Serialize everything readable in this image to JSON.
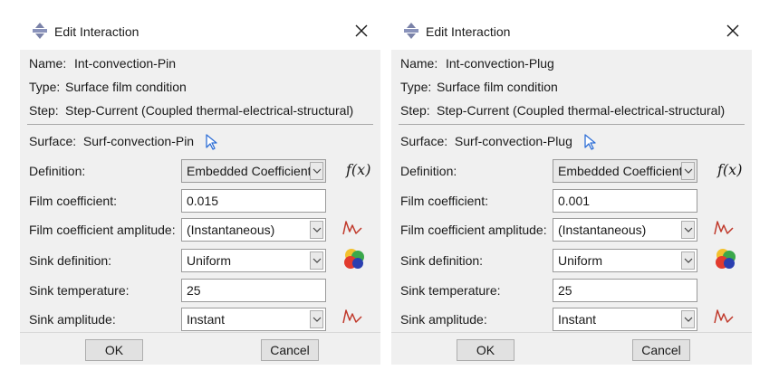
{
  "dialogs": [
    {
      "title": "Edit Interaction",
      "name_label": "Name:",
      "name_value": "Int-convection-Pin",
      "type_label": "Type:",
      "type_value": "Surface film condition",
      "step_label": "Step:",
      "step_value": "Step-Current (Coupled thermal-electrical-structural)",
      "surface_label": "Surface:",
      "surface_value": "Surf-convection-Pin",
      "definition_label": "Definition:",
      "definition_value": "Embedded Coefficient",
      "fx_label": "f(x)",
      "film_coefficient_label": "Film coefficient:",
      "film_coefficient_value": "0.015",
      "film_amplitude_label": "Film coefficient amplitude:",
      "film_amplitude_value": "(Instantaneous)",
      "sink_definition_label": "Sink definition:",
      "sink_definition_value": "Uniform",
      "sink_temperature_label": "Sink temperature:",
      "sink_temperature_value": "25",
      "sink_amplitude_label": "Sink amplitude:",
      "sink_amplitude_value": "Instant",
      "ok_label": "OK",
      "cancel_label": "Cancel"
    },
    {
      "title": "Edit Interaction",
      "name_label": "Name:",
      "name_value": "Int-convection-Plug",
      "type_label": "Type:",
      "type_value": "Surface film condition",
      "step_label": "Step:",
      "step_value": "Step-Current (Coupled thermal-electrical-structural)",
      "surface_label": "Surface:",
      "surface_value": "Surf-convection-Plug",
      "definition_label": "Definition:",
      "definition_value": "Embedded Coefficient",
      "fx_label": "f(x)",
      "film_coefficient_label": "Film coefficient:",
      "film_coefficient_value": "0.001",
      "film_amplitude_label": "Film coefficient amplitude:",
      "film_amplitude_value": "(Instantaneous)",
      "sink_definition_label": "Sink definition:",
      "sink_definition_value": "Uniform",
      "sink_temperature_label": "Sink temperature:",
      "sink_temperature_value": "25",
      "sink_amplitude_label": "Sink amplitude:",
      "sink_amplitude_value": "Instant",
      "ok_label": "OK",
      "cancel_label": "Cancel"
    }
  ],
  "icons": {
    "title": "abaqus-interaction-icon",
    "close": "close-icon",
    "select_surface": "cursor-arrow-icon",
    "function": "fx-icon",
    "amplitude": "amplitude-curve-icon",
    "sink_distribution": "color-palette-icon"
  },
  "colors": {
    "dialog_bg": "#f0f0f0",
    "titlebar_bg": "#ffffff",
    "amplitude_icon": "#c0392b",
    "cursor_icon": "#2f6fd6"
  }
}
